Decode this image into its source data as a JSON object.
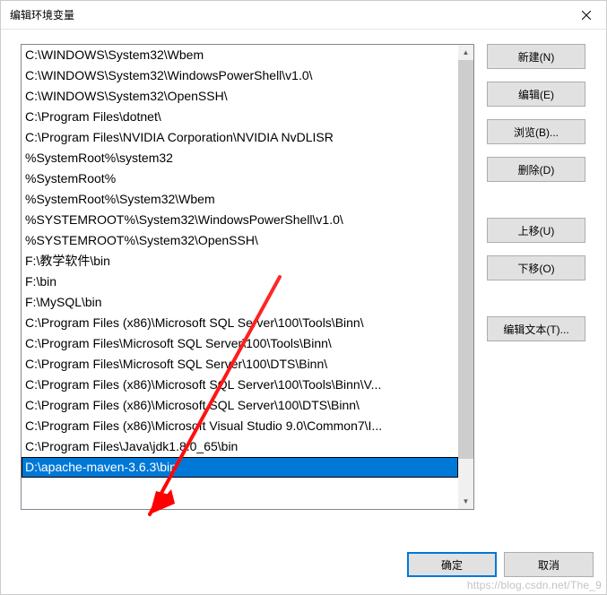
{
  "titlebar": {
    "title": "编辑环境变量"
  },
  "list": {
    "items": [
      "C:\\WINDOWS\\System32\\Wbem",
      "C:\\WINDOWS\\System32\\WindowsPowerShell\\v1.0\\",
      "C:\\WINDOWS\\System32\\OpenSSH\\",
      "C:\\Program Files\\dotnet\\",
      "C:\\Program Files\\NVIDIA Corporation\\NVIDIA NvDLISR",
      "%SystemRoot%\\system32",
      "%SystemRoot%",
      "%SystemRoot%\\System32\\Wbem",
      "%SYSTEMROOT%\\System32\\WindowsPowerShell\\v1.0\\",
      "%SYSTEMROOT%\\System32\\OpenSSH\\",
      "F:\\教学软件\\bin",
      "F:\\bin",
      "F:\\MySQL\\bin",
      "C:\\Program Files (x86)\\Microsoft SQL Server\\100\\Tools\\Binn\\",
      "C:\\Program Files\\Microsoft SQL Server\\100\\Tools\\Binn\\",
      "C:\\Program Files\\Microsoft SQL Server\\100\\DTS\\Binn\\",
      "C:\\Program Files (x86)\\Microsoft SQL Server\\100\\Tools\\Binn\\V...",
      "C:\\Program Files (x86)\\Microsoft SQL Server\\100\\DTS\\Binn\\",
      "C:\\Program Files (x86)\\Microsoft Visual Studio 9.0\\Common7\\I...",
      "C:\\Program Files\\Java\\jdk1.8.0_65\\bin",
      "D:\\apache-maven-3.6.3\\bin"
    ],
    "selectedIndex": 20
  },
  "buttons": {
    "new_label": "新建(N)",
    "edit_label": "编辑(E)",
    "browse_label": "浏览(B)...",
    "delete_label": "删除(D)",
    "moveup_label": "上移(U)",
    "movedown_label": "下移(O)",
    "edittext_label": "编辑文本(T)..."
  },
  "footer": {
    "ok_label": "确定",
    "cancel_label": "取消"
  },
  "watermark": "https://blog.csdn.net/The_9"
}
